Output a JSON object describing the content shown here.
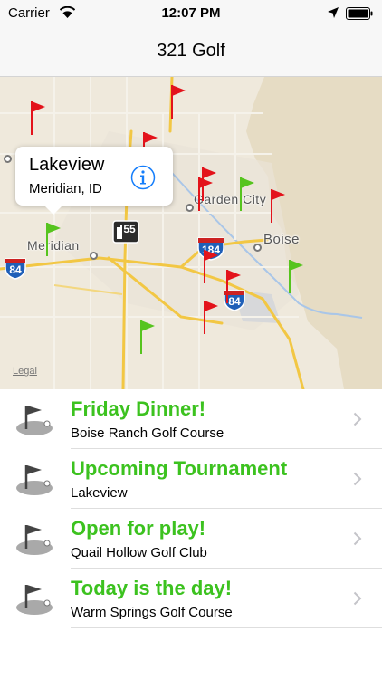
{
  "status_bar": {
    "carrier": "Carrier",
    "time": "12:07 PM"
  },
  "nav": {
    "title": "321 Golf"
  },
  "map": {
    "labels": {
      "meridian": "Meridian",
      "garden_city": "Garden City",
      "boise": "Boise",
      "legal": "Legal"
    },
    "highway_shields": {
      "i84_west": "84",
      "i184": "184",
      "i84_east": "84",
      "id55": "55"
    },
    "callout": {
      "title": "Lakeview",
      "subtitle": "Meridian, ID"
    },
    "flag_colors": {
      "red": "#e3131b",
      "green": "#56c41e"
    }
  },
  "list": [
    {
      "title": "Friday Dinner!",
      "subtitle": "Boise Ranch Golf Course"
    },
    {
      "title": "Upcoming Tournament",
      "subtitle": "Lakeview"
    },
    {
      "title": "Open for play!",
      "subtitle": "Quail Hollow Golf Club"
    },
    {
      "title": "Today is the day!",
      "subtitle": "Warm Springs Golf Course"
    }
  ],
  "colors": {
    "accent_green": "#3cc21f",
    "info_blue": "#157efb"
  }
}
